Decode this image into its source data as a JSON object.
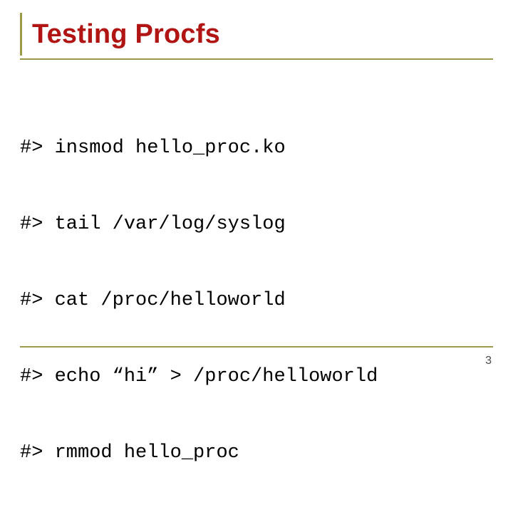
{
  "title": "Testing Procfs",
  "code_lines": [
    "#> insmod hello_proc.ko",
    "#> tail /var/log/syslog",
    "#> cat /proc/helloworld",
    "#> echo “hi” > /proc/helloworld",
    "#> rmmod hello_proc"
  ],
  "page_number": "3"
}
